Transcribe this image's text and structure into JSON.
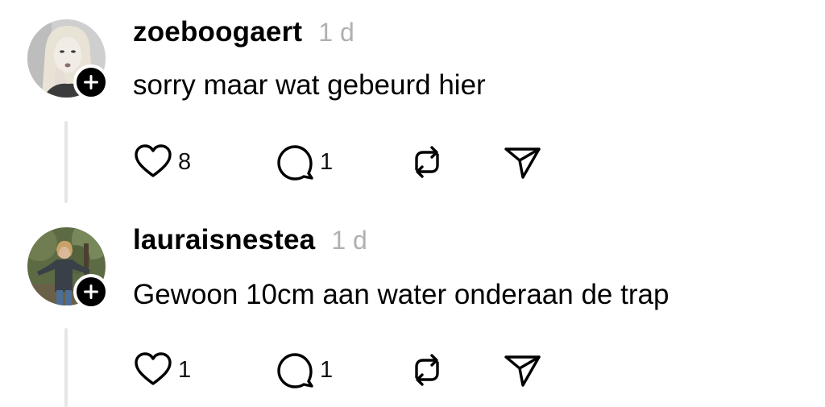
{
  "comments": [
    {
      "username": "zoeboogaert",
      "timestamp": "1 d",
      "text": "sorry maar wat gebeurd hier",
      "likes": "8",
      "replies": "1",
      "avatar": "portrait-photo-blonde-woman"
    },
    {
      "username": "lauraisnestea",
      "timestamp": "1 d",
      "text": "Gewoon 10cm aan water onderaan de trap",
      "likes": "1",
      "replies": "1",
      "avatar": "outdoor-photo-person-in-park"
    }
  ],
  "icons": {
    "like": "heart-icon",
    "reply": "speech-bubble-icon",
    "repost": "repost-icon",
    "share": "paper-plane-icon",
    "follow": "plus-icon"
  },
  "colors": {
    "text": "#000000",
    "muted": "#b0b0b0",
    "thread_line": "#e5e5e5",
    "badge": "#000000"
  }
}
